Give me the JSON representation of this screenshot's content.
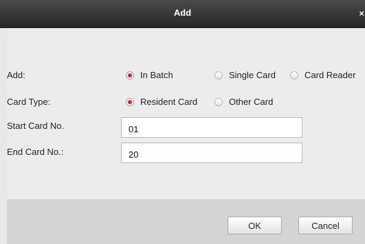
{
  "dialog": {
    "title": "Add",
    "close_glyph": "×"
  },
  "form": {
    "add": {
      "label": "Add:",
      "options": [
        {
          "label": "In Batch",
          "selected": true
        },
        {
          "label": "Single Card",
          "selected": false
        },
        {
          "label": "Card Reader",
          "selected": false
        }
      ]
    },
    "card_type": {
      "label": "Card Type:",
      "options": [
        {
          "label": "Resident Card",
          "selected": true
        },
        {
          "label": "Other Card",
          "selected": false
        }
      ]
    },
    "start_card": {
      "label": "Start Card No.",
      "value": "01"
    },
    "end_card": {
      "label": "End Card No.:",
      "value": "20"
    }
  },
  "footer": {
    "ok_label": "OK",
    "cancel_label": "Cancel"
  },
  "colors": {
    "titlebar": "#333333",
    "radio_selected": "#e02020",
    "footer": "#d4d4d4"
  }
}
